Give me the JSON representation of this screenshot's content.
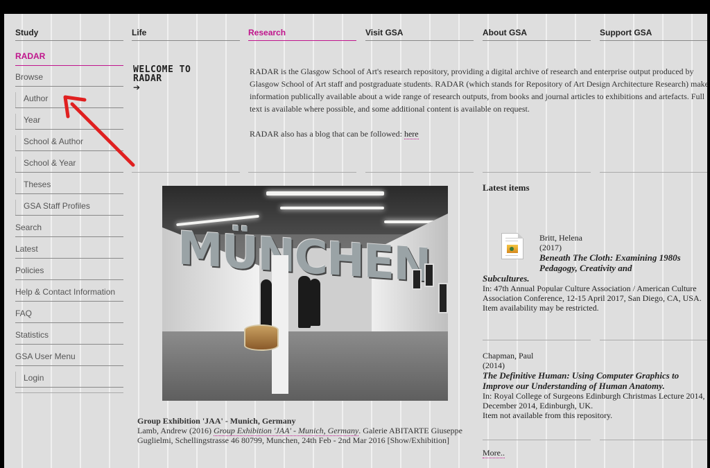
{
  "topnav": [
    {
      "label": "Study",
      "active": false
    },
    {
      "label": "Life",
      "active": false
    },
    {
      "label": "Research",
      "active": true
    },
    {
      "label": "Visit GSA",
      "active": false
    },
    {
      "label": "About GSA",
      "active": false
    },
    {
      "label": "Support GSA",
      "active": false
    }
  ],
  "sidebar": {
    "items": [
      {
        "label": "RADAR",
        "type": "section"
      },
      {
        "label": "Browse",
        "type": "top"
      },
      {
        "label": "Author",
        "type": "sub"
      },
      {
        "label": "Year",
        "type": "sub"
      },
      {
        "label": "School & Author",
        "type": "sub"
      },
      {
        "label": "School & Year",
        "type": "sub"
      },
      {
        "label": "Theses",
        "type": "sub"
      },
      {
        "label": "GSA Staff Profiles",
        "type": "sub"
      },
      {
        "label": "Search",
        "type": "top"
      },
      {
        "label": "Latest",
        "type": "top"
      },
      {
        "label": "Policies",
        "type": "top"
      },
      {
        "label": "Help & Contact Information",
        "type": "top"
      },
      {
        "label": "FAQ",
        "type": "top"
      },
      {
        "label": "Statistics",
        "type": "top"
      },
      {
        "label": "GSA User Menu",
        "type": "top"
      },
      {
        "label": "Login",
        "type": "sub"
      }
    ]
  },
  "welcome": {
    "line1": "WELCOME TO",
    "line2": "RADAR",
    "arrow": "➔"
  },
  "intro": {
    "paragraph1": "RADAR is the Glasgow School of Art's research repository, providing a digital archive of research and enterprise output produced by Glasgow School of Art staff and postgraduate students. RADAR (which stands for Repository of Art Design Architecture Research) makes information publically available about a wide range of research outputs, from books and journal articles to exhibitions and artefacts. Full text is available where possible, and some additional content is available on request.",
    "paragraph2_prefix": "RADAR also has a blog that can be followed: ",
    "paragraph2_link": "here"
  },
  "featured": {
    "image_text": "MÜNCHEN",
    "title": "Group Exhibition 'JAA' - Munich, Germany",
    "citation_prefix": "Lamb, Andrew (2016) ",
    "citation_link": "Group Exhibition 'JAA' - Munich, Germany",
    "citation_rest": ". Galerie ABITARTE Giuseppe Guglielmi, Schellingstrasse 46 80799, Munchen, 24th Feb - 2nd Mar 2016 [Show/Exhibition]"
  },
  "latest": {
    "heading": "Latest items",
    "items": [
      {
        "author": "Britt, Helena",
        "year": "(2017)",
        "title_part1": "Beneath The Cloth: Examining 1980s",
        "title_part2": "Pedagogy, Creativity and",
        "title_part3": "Subcultures.",
        "venue": "In: 47th Annual Popular Culture Association / American Culture Association Conference, 12-15 April 2017, San Diego, CA, USA.",
        "availability": "Item availability may be restricted."
      },
      {
        "author": "Chapman, Paul",
        "year": "(2014)",
        "title": "The Definitive Human: Using Computer Graphics to Improve our Understanding of Human Anatomy.",
        "venue": "In: Royal College of Surgeons Edinburgh Christmas Lecture 2014, December 2014, Edinburgh, UK.",
        "availability": "Item not available from this repository."
      }
    ],
    "more_label": "More.."
  },
  "colors": {
    "accent": "#c0148c",
    "page_background": "#dedede",
    "annotation_arrow": "#e02020"
  }
}
